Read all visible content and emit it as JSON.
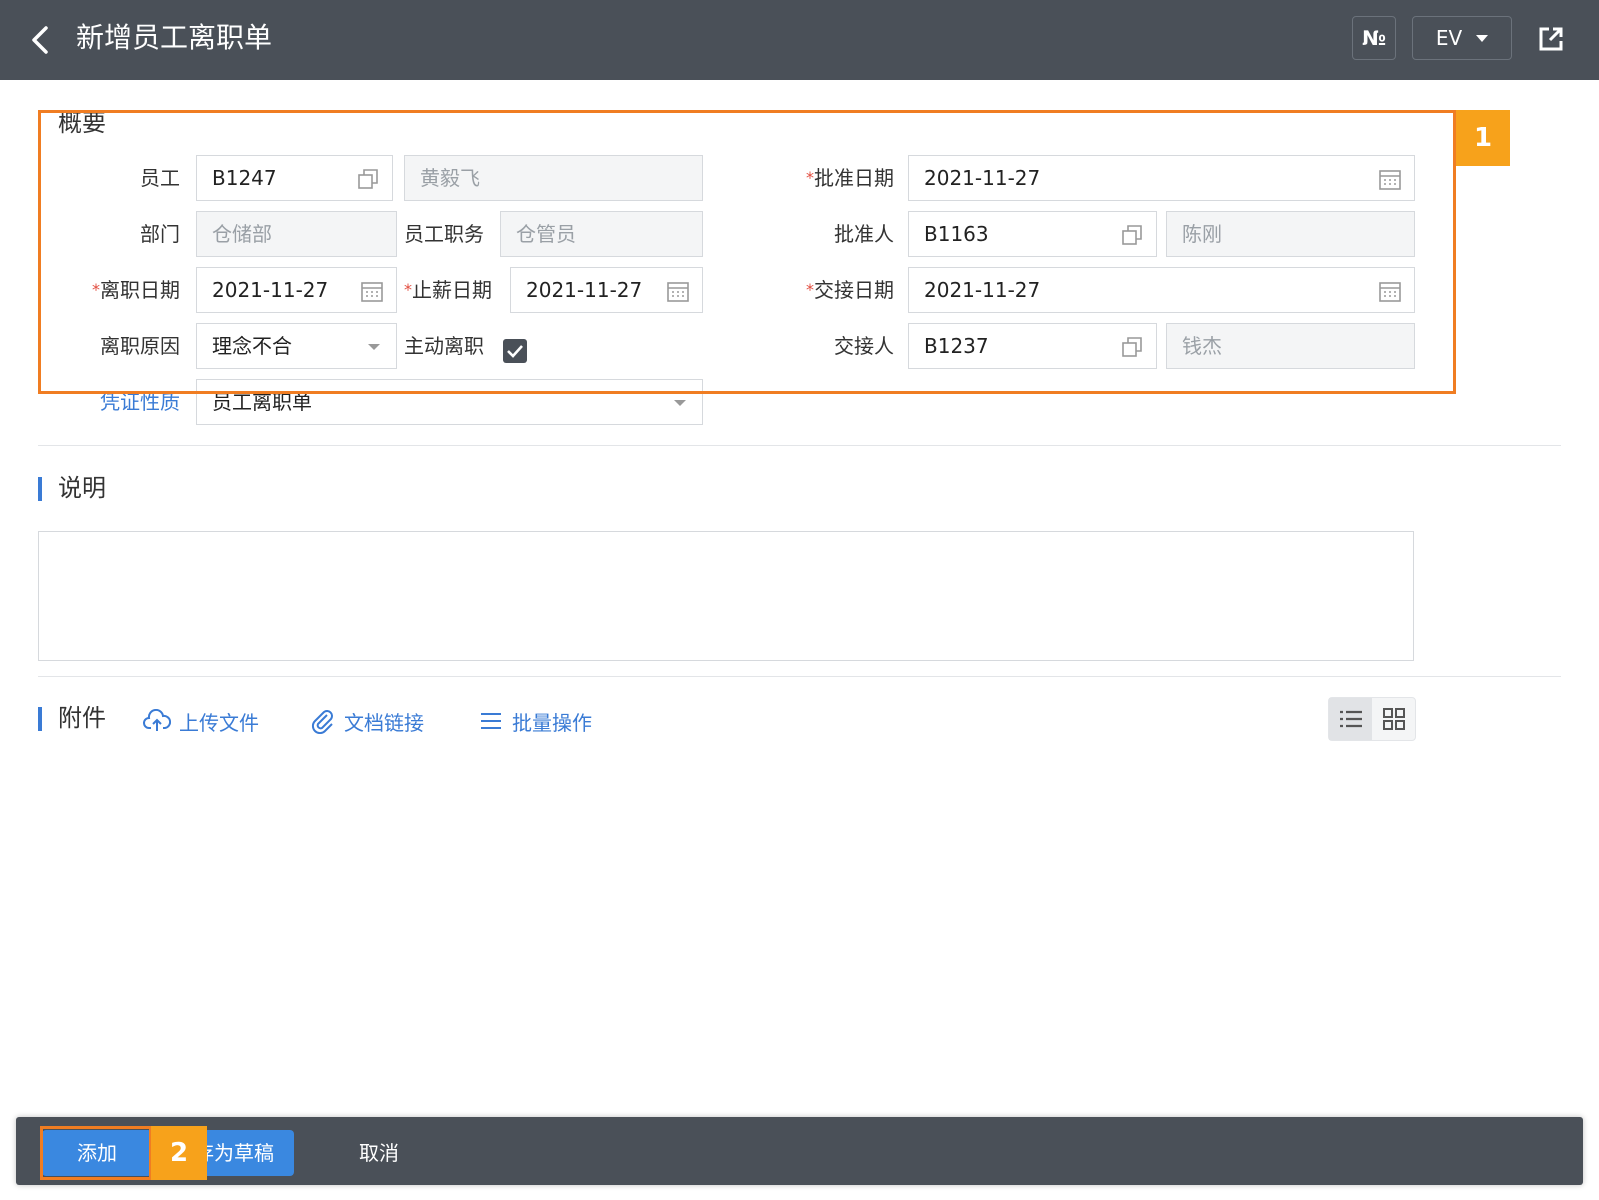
{
  "header": {
    "title": "新增员工离职单",
    "numbering_button": "№",
    "lang_button": "EV"
  },
  "overview": {
    "section_title": "概要",
    "employee": {
      "label": "员工",
      "code": "B1247",
      "name": "黄毅飞"
    },
    "department": {
      "label": "部门",
      "value": "仓储部"
    },
    "position": {
      "label": "员工职务",
      "value": "仓管员"
    },
    "leave_date": {
      "label": "离职日期",
      "value": "2021-11-27"
    },
    "salary_stop_date": {
      "label": "止薪日期",
      "value": "2021-11-27"
    },
    "leave_reason": {
      "label": "离职原因",
      "value": "理念不合"
    },
    "voluntary": {
      "label": "主动离职",
      "checked": true
    },
    "approve_date": {
      "label": "批准日期",
      "value": "2021-11-27"
    },
    "approver": {
      "label": "批准人",
      "code": "B1163",
      "name": "陈刚"
    },
    "handover_date": {
      "label": "交接日期",
      "value": "2021-11-27"
    },
    "handover_person": {
      "label": "交接人",
      "code": "B1237",
      "name": "钱杰"
    },
    "voucher_type": {
      "label": "凭证性质",
      "value": "员工离职单"
    },
    "required_mark": "*"
  },
  "notes": {
    "section_title": "说明"
  },
  "attachments": {
    "section_title": "附件",
    "upload": "上传文件",
    "doc_link": "文档链接",
    "batch": "批量操作"
  },
  "footer": {
    "add": "添加",
    "save_draft": "存为草稿",
    "cancel": "取消"
  },
  "annotations": {
    "badge1": "1",
    "badge2": "2"
  },
  "colors": {
    "topbar": "#4a5058",
    "accent": "#3a88e0",
    "annotation": "#f07d22",
    "badge": "#f7a21b"
  }
}
